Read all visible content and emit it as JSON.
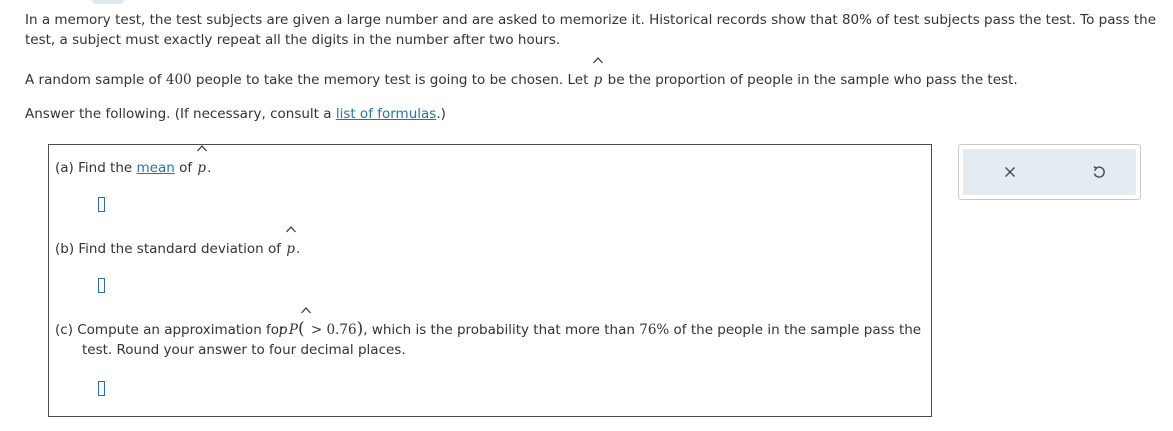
{
  "intro": {
    "text": "In a memory test, the test subjects are given a large number and are asked to memorize it. Historical records show that 80% of test subjects pass the test. To pass the test, a subject must exactly repeat all the digits in the number after two hours."
  },
  "para2": {
    "before": "A random sample of ",
    "n": "400",
    "middle": " people to take the memory test is going to be chosen. Let ",
    "variable": "p",
    "after": " be the proportion of people in the sample who pass the test."
  },
  "para3": {
    "before": "Answer the following. (If necessary, consult a ",
    "link": "list of formulas",
    "after": ".)"
  },
  "questions": {
    "a": {
      "prefix": "(a) Find the ",
      "link": "mean",
      "middle": " of ",
      "variable": "p",
      "suffix": "."
    },
    "b": {
      "prefix": "(b) Find the standard deviation of ",
      "variable": "p",
      "suffix": "."
    },
    "c": {
      "prefix": "(c) Compute an approximation for ",
      "prob": "P",
      "variable": "p",
      "gt": " > ",
      "threshold": "0.76",
      "after_expr": ", which is the probability that more than ",
      "percent": "76%",
      "rest": " of the people in the sample pass the test. Round your answer to four decimal places."
    }
  },
  "answers": {
    "a": "",
    "b": "",
    "c": ""
  },
  "tools": {
    "clear_icon": "close-icon",
    "undo_icon": "undo-icon"
  }
}
